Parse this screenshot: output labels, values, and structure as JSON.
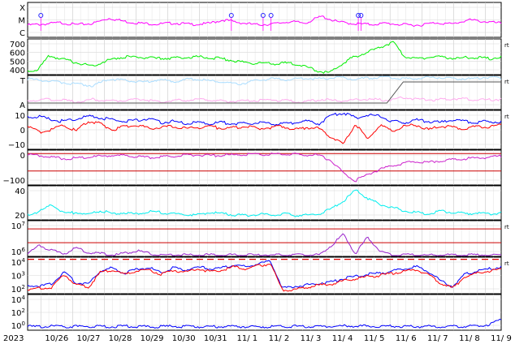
{
  "chart_data": {
    "type": "line",
    "title": "",
    "year_label": "2023",
    "x_ticks": [
      "10/26",
      "10/27",
      "10/28",
      "10/29",
      "10/30",
      "10/31",
      "11/ 1",
      "11/ 2",
      "11/ 3",
      "11/ 4",
      "11/ 5",
      "11/ 6",
      "11/ 7",
      "11/ 8",
      "11/ 9"
    ],
    "x_range": [
      "2023-10-25T14:00",
      "2023-11-09T12:00"
    ],
    "panels": [
      {
        "id": "xray-flares",
        "y_tick_labels": [
          "X",
          "M",
          "C"
        ],
        "scale": "categorical",
        "series": [
          {
            "color": "#ff00ff",
            "values": [
              0.35,
              0.38,
              0.42,
              0.36,
              0.4,
              0.55,
              0.45,
              0.4,
              0.38,
              0.41,
              0.37,
              0.39,
              0.5,
              0.42,
              0.36,
              0.38,
              0.45,
              0.41,
              0.6,
              0.44,
              0.39,
              0.37,
              0.4,
              0.36,
              0.35,
              0.42,
              0.38,
              0.5,
              0.45,
              0.4
            ]
          }
        ],
        "markers": [
          {
            "x": "2023-10-26T00:00",
            "level": "M"
          },
          {
            "x": "2023-11-01T00:00",
            "level": "M"
          },
          {
            "x": "2023-11-02T00:00",
            "level": "M"
          },
          {
            "x": "2023-11-02T06:00",
            "level": "M"
          },
          {
            "x": "2023-11-05T00:00",
            "level": "M"
          },
          {
            "x": "2023-11-05T02:00",
            "level": "M"
          }
        ],
        "right_tag": ""
      },
      {
        "id": "solar-wind-speed",
        "y_tick_labels": [
          "700",
          "600",
          "500",
          "400"
        ],
        "ylim": [
          380,
          780
        ],
        "series": [
          {
            "color": "#00ee00",
            "values": [
              420,
              440,
              590,
              560,
              530,
              500,
              480,
              520,
              560,
              580,
              575,
              570,
              560,
              565,
              570,
              575,
              580,
              570,
              560,
              540,
              520,
              510,
              505,
              500,
              510,
              500,
              460,
              420,
              400,
              480,
              560,
              610,
              650,
              700,
              740,
              580,
              560,
              570,
              580,
              570,
              560,
              575,
              570,
              560,
              580
            ]
          }
        ],
        "right_tag": "rt"
      },
      {
        "id": "imf-direction",
        "y_tick_labels": [
          "T",
          "A"
        ],
        "series": [
          {
            "name": "",
            "color": "#aaddff",
            "values": [
              0.9,
              0.85,
              0.8,
              0.75,
              0.7,
              0.9,
              0.85,
              0.8,
              0.88,
              0.82,
              0.9,
              0.85,
              0.8,
              0.75,
              0.85,
              0.9,
              0.88,
              0.92,
              0.9,
              0.95,
              0.9,
              0.92,
              0.95,
              0.9,
              0.93,
              0.95,
              0.92,
              0.9,
              0.95,
              0.92
            ]
          },
          {
            "name": "",
            "color": "#ffaaee",
            "values": [
              0.25,
              0.3,
              0.28,
              0.22,
              0.3,
              0.25,
              0.27,
              0.3,
              0.22,
              0.26,
              0.28,
              0.3,
              0.24,
              0.25,
              0.27,
              0.28,
              0.25,
              0.22,
              0.3,
              0.25,
              0.28,
              0.3,
              0.27,
              0.35,
              0.3,
              0.28,
              0.32,
              0.3,
              0.28,
              0.3
            ]
          }
        ],
        "sector_line": [
          0,
          0,
          0,
          0,
          0,
          0,
          0,
          0,
          0,
          0,
          0,
          0,
          0,
          0,
          0,
          0,
          0,
          0,
          0,
          0,
          0,
          0,
          0,
          1,
          1,
          1,
          1,
          1,
          1,
          1
        ],
        "right_tag": "rt"
      },
      {
        "id": "imf-bt-bz",
        "y_tick_labels": [
          "10",
          "0",
          "−10"
        ],
        "ylim": [
          -18,
          14
        ],
        "series": [
          {
            "color": "#0000ff",
            "values": [
              8,
              9,
              6,
              5,
              7,
              9,
              8,
              6,
              5,
              6,
              7,
              4,
              5,
              3,
              4,
              3,
              4,
              3,
              3,
              4,
              3,
              3,
              4,
              5,
              3,
              10,
              12,
              8,
              10,
              9,
              5,
              4,
              6,
              5,
              4,
              6,
              5,
              4,
              5,
              4
            ]
          },
          {
            "color": "#ff0000",
            "values": [
              1,
              -4,
              -2,
              2,
              -3,
              5,
              3,
              -2,
              1,
              2,
              -1,
              0,
              1,
              -1,
              0,
              1,
              -1,
              0,
              1,
              -1,
              0,
              1,
              -2,
              0,
              -1,
              -8,
              -14,
              3,
              -10,
              2,
              -3,
              1,
              2,
              -2,
              1,
              0,
              -1,
              1,
              0,
              2
            ]
          }
        ],
        "right_tag": "rt"
      },
      {
        "id": "dst-index",
        "y_tick_labels": [
          "0",
          "−100"
        ],
        "ylim": [
          -180,
          20
        ],
        "series": [
          {
            "color": "#cc22cc",
            "values": [
              -5,
              -10,
              -20,
              -30,
              -25,
              -20,
              -15,
              -10,
              -12,
              -18,
              -22,
              -20,
              -15,
              -10,
              -8,
              -12,
              -10,
              -8,
              -6,
              -5,
              -4,
              -6,
              -5,
              -8,
              -10,
              -40,
              -110,
              -155,
              -120,
              -90,
              -70,
              -55,
              -45,
              -50,
              -40,
              -35,
              -30,
              -25,
              -20,
              -15
            ]
          }
        ],
        "red_lines": [
          0,
          -100
        ],
        "right_tag": ""
      },
      {
        "id": "auroral-index",
        "y_tick_labels": [
          "40",
          "20"
        ],
        "ylim": [
          0,
          55
        ],
        "series": [
          {
            "color": "#00eeee",
            "values": [
              8,
              14,
              25,
              10,
              12,
              8,
              15,
              10,
              12,
              9,
              14,
              12,
              10,
              9,
              8,
              12,
              10,
              8,
              7,
              9,
              8,
              10,
              7,
              8,
              9,
              18,
              30,
              48,
              35,
              25,
              20,
              15,
              12,
              10,
              14,
              12,
              10,
              11,
              9,
              12
            ]
          }
        ],
        "right_tag": ""
      },
      {
        "id": "electron-flux",
        "y_tick_labels": [
          "10^7",
          "10^6"
        ],
        "ylim_log": [
          5,
          7.6
        ],
        "series": [
          {
            "color": "#9922cc",
            "values": [
              5.2,
              5.8,
              5.4,
              5.2,
              5.6,
              5.3,
              5.2,
              5.1,
              5.2,
              5.4,
              5.2,
              5.1,
              5.1,
              5.1,
              5.1,
              5.1,
              5.1,
              5.1,
              5.1,
              5.1,
              5.1,
              5.1,
              5.1,
              5.1,
              5.1,
              5.8,
              6.6,
              5.2,
              6.4,
              5.4,
              5.1,
              5.1,
              5.1,
              5.1,
              5.1,
              5.1,
              5.1,
              5.1,
              5.1,
              5.1
            ]
          }
        ],
        "red_lines": [
          7,
          6
        ],
        "right_tag": "rt"
      },
      {
        "id": "proton-flux",
        "y_tick_labels": [
          "10^4",
          "10^3",
          "10^2"
        ],
        "ylim_log": [
          0.8,
          4.2
        ],
        "series": [
          {
            "color": "#0000ff",
            "values": [
              1.6,
              1.5,
              1.7,
              2.8,
              1.8,
              1.7,
              2.9,
              3.2,
              2.7,
              3.1,
              3.2,
              2.8,
              3.2,
              3.0,
              3.3,
              3.1,
              3.2,
              3.5,
              3.3,
              3.6,
              3.8,
              1.3,
              1.5,
              1.6,
              1.8,
              1.9,
              2.2,
              2.4,
              2.6,
              2.7,
              2.9,
              3.1,
              3.3,
              2.9,
              2.0,
              1.5,
              2.6,
              2.9,
              3.1,
              3.3
            ]
          },
          {
            "color": "#ff0000",
            "values": [
              1.2,
              1.3,
              1.4,
              2.6,
              1.6,
              1.4,
              2.8,
              3.0,
              2.6,
              2.9,
              3.0,
              2.6,
              3.0,
              2.8,
              3.1,
              2.9,
              3.0,
              3.3,
              3.1,
              3.4,
              3.6,
              1.1,
              1.2,
              1.4,
              1.6,
              1.7,
              2.0,
              2.2,
              2.4,
              2.5,
              2.7,
              2.9,
              3.0,
              2.6,
              1.8,
              1.3,
              2.4,
              2.7,
              2.9,
              3.1
            ]
          }
        ],
        "dashed_line": 4,
        "right_tag": "rt"
      },
      {
        "id": "proton-high",
        "y_tick_labels": [
          "10^4",
          "10^2",
          "10^0"
        ],
        "ylim_log": [
          -0.5,
          4.5
        ],
        "series": [
          {
            "color": "#0000ff",
            "values": [
              0,
              0,
              0.05,
              0,
              0,
              0.05,
              0,
              0,
              0.05,
              0,
              0,
              0,
              0.05,
              0,
              0,
              0,
              0,
              0.05,
              0,
              0,
              0,
              0,
              0.05,
              0,
              0,
              0.05,
              0.1,
              0.1,
              0.05,
              0.05,
              0.05,
              0,
              0,
              0.05,
              0,
              0,
              0.05,
              0.1,
              0.3,
              1.0
            ]
          }
        ],
        "right_tag": ""
      }
    ],
    "grid": true,
    "legend": "none"
  }
}
